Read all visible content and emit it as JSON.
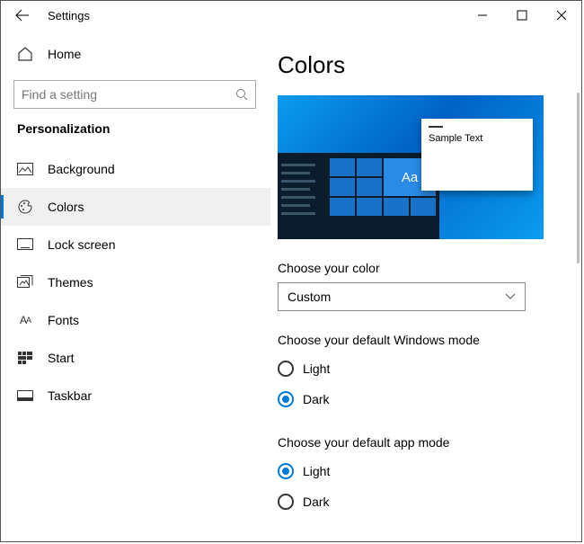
{
  "titlebar": {
    "app_name": "Settings"
  },
  "sidebar": {
    "home_label": "Home",
    "search_placeholder": "Find a setting",
    "section": "Personalization",
    "items": [
      {
        "label": "Background"
      },
      {
        "label": "Colors"
      },
      {
        "label": "Lock screen"
      },
      {
        "label": "Themes"
      },
      {
        "label": "Fonts"
      },
      {
        "label": "Start"
      },
      {
        "label": "Taskbar"
      }
    ]
  },
  "main": {
    "title": "Colors",
    "preview_sample_text": "Sample Text",
    "preview_tile_text": "Aa",
    "choose_color_label": "Choose your color",
    "choose_color_value": "Custom",
    "windows_mode_label": "Choose your default Windows mode",
    "windows_mode_options": {
      "light": "Light",
      "dark": "Dark"
    },
    "windows_mode_selected": "dark",
    "app_mode_label": "Choose your default app mode",
    "app_mode_options": {
      "light": "Light",
      "dark": "Dark"
    },
    "app_mode_selected": "light"
  }
}
